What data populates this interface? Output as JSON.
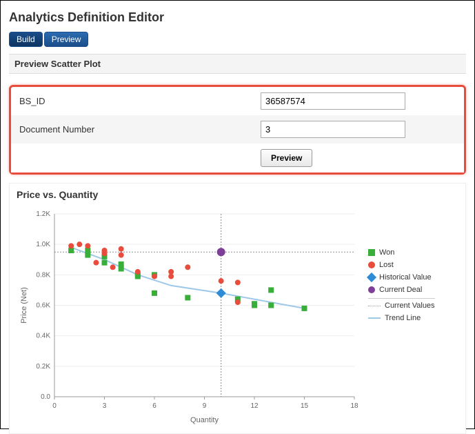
{
  "header": {
    "title": "Analytics Definition Editor"
  },
  "tabs": {
    "build": "Build",
    "preview": "Preview"
  },
  "section": {
    "title": "Preview Scatter Plot"
  },
  "form": {
    "bs_id": {
      "label": "BS_ID",
      "value": "36587574"
    },
    "doc_num": {
      "label": "Document Number",
      "value": "3"
    },
    "preview_btn": "Preview"
  },
  "chart_data": {
    "type": "scatter",
    "title": "Price vs. Quantity",
    "xlabel": "Quantity",
    "ylabel": "Price (Net)",
    "xlim": [
      0,
      18
    ],
    "ylim": [
      0,
      1.2
    ],
    "xticks": [
      0,
      3,
      6,
      9,
      12,
      15,
      18
    ],
    "yticks": [
      0.0,
      0.2,
      0.4,
      0.6,
      0.8,
      1.0,
      1.2
    ],
    "ytick_labels": [
      "0.0",
      "0.2K",
      "0.4K",
      "0.6K",
      "0.8K",
      "1.0K",
      "1.2K"
    ],
    "series": [
      {
        "name": "Won",
        "color": "#3aae3a",
        "marker": "square",
        "points": [
          {
            "x": 1,
            "y": 0.96
          },
          {
            "x": 2,
            "y": 0.96
          },
          {
            "x": 2,
            "y": 0.93
          },
          {
            "x": 3,
            "y": 0.92
          },
          {
            "x": 3,
            "y": 0.88
          },
          {
            "x": 4,
            "y": 0.87
          },
          {
            "x": 4,
            "y": 0.84
          },
          {
            "x": 5,
            "y": 0.79
          },
          {
            "x": 5,
            "y": 0.8
          },
          {
            "x": 6,
            "y": 0.8
          },
          {
            "x": 6,
            "y": 0.68
          },
          {
            "x": 8,
            "y": 0.65
          },
          {
            "x": 11,
            "y": 0.64
          },
          {
            "x": 12,
            "y": 0.61
          },
          {
            "x": 12,
            "y": 0.6
          },
          {
            "x": 13,
            "y": 0.7
          },
          {
            "x": 13,
            "y": 0.6
          },
          {
            "x": 15,
            "y": 0.58
          }
        ]
      },
      {
        "name": "Lost",
        "color": "#e74c3c",
        "marker": "circle",
        "points": [
          {
            "x": 1,
            "y": 0.99
          },
          {
            "x": 1.5,
            "y": 1.0
          },
          {
            "x": 2,
            "y": 0.99
          },
          {
            "x": 2.5,
            "y": 0.88
          },
          {
            "x": 3,
            "y": 0.96
          },
          {
            "x": 3,
            "y": 0.94
          },
          {
            "x": 3.5,
            "y": 0.85
          },
          {
            "x": 4,
            "y": 0.93
          },
          {
            "x": 4,
            "y": 0.97
          },
          {
            "x": 5,
            "y": 0.82
          },
          {
            "x": 6,
            "y": 0.79
          },
          {
            "x": 7,
            "y": 0.82
          },
          {
            "x": 7,
            "y": 0.79
          },
          {
            "x": 8,
            "y": 0.85
          },
          {
            "x": 10,
            "y": 0.76
          },
          {
            "x": 11,
            "y": 0.75
          },
          {
            "x": 11,
            "y": 0.62
          }
        ]
      },
      {
        "name": "Historical Value",
        "color": "#2e8bd6",
        "marker": "diamond",
        "points": [
          {
            "x": 10,
            "y": 0.68
          }
        ]
      },
      {
        "name": "Current Deal",
        "color": "#7e3f98",
        "marker": "large-circle",
        "points": [
          {
            "x": 10,
            "y": 0.95
          }
        ]
      }
    ],
    "trend_line": {
      "name": "Trend Line",
      "color": "#9ec8e8",
      "points": [
        {
          "x": 1,
          "y": 0.98
        },
        {
          "x": 3,
          "y": 0.9
        },
        {
          "x": 5,
          "y": 0.8
        },
        {
          "x": 7,
          "y": 0.73
        },
        {
          "x": 10,
          "y": 0.68
        },
        {
          "x": 13,
          "y": 0.62
        },
        {
          "x": 15,
          "y": 0.58
        }
      ]
    },
    "current_values": {
      "name": "Current Values",
      "x": 10,
      "y": 0.95
    },
    "legend": {
      "won": "Won",
      "lost": "Lost",
      "historical": "Historical Value",
      "current_deal": "Current Deal",
      "current_values": "Current Values",
      "trend": "Trend Line"
    }
  }
}
